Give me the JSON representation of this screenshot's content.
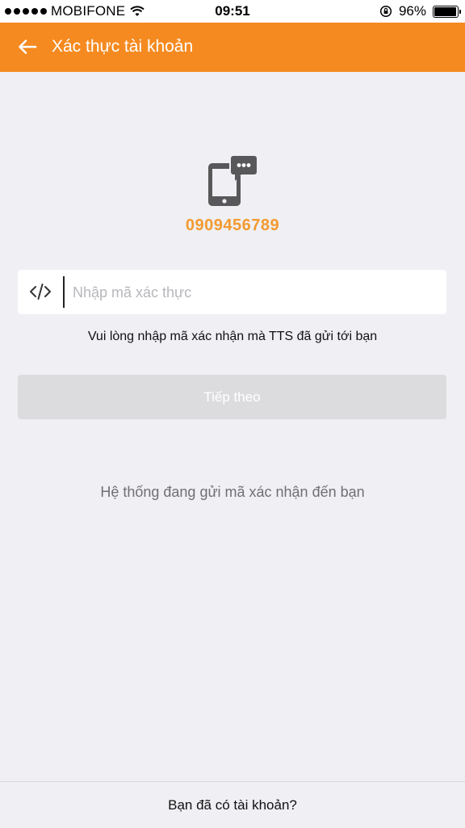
{
  "status_bar": {
    "carrier": "MOBIFONE",
    "time": "09:51",
    "battery": "96%",
    "icons": [
      "signal-dots-icon",
      "wifi-icon",
      "rotation-lock-icon",
      "battery-icon"
    ]
  },
  "header": {
    "back_icon": "arrow-left-icon",
    "title": "Xác thực tài khoản",
    "background_color": "#f58a20"
  },
  "verification": {
    "icon": "phone-message-icon",
    "phone_number": "0909456789",
    "phone_color": "#f39a2f"
  },
  "code_field": {
    "icon": "code-icon",
    "placeholder": "Nhập mã xác thực",
    "value": ""
  },
  "hint_text": "Vui lòng nhập mã xác nhận mà TTS đã gửi tới bạn",
  "next_button": {
    "label": "Tiếp theo",
    "enabled": false
  },
  "sending_status": "Hệ thống đang gửi mã xác nhận đến bạn",
  "footer": {
    "link_label": "Bạn đã có tài khoản?"
  }
}
